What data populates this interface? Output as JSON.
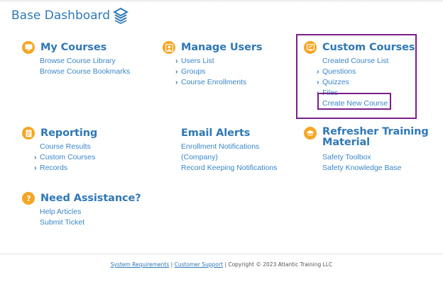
{
  "page": {
    "title": "Base Dashboard"
  },
  "colors": {
    "accent": "#2f78b6",
    "link": "#3a86c8",
    "icon_bg": "#f5a623",
    "highlight": "#7b1f8a"
  },
  "sections": {
    "my_courses": {
      "title": "My Courses",
      "icon": "monitor-icon",
      "links": [
        "Browse Course Library",
        "Browse Course Bookmarks"
      ]
    },
    "manage_users": {
      "title": "Manage Users",
      "icon": "user-badge-icon",
      "links": [
        "Users List",
        "Groups",
        "Course Enrollments"
      ]
    },
    "custom_courses": {
      "title": "Custom Courses",
      "icon": "screen-edit-icon",
      "links": [
        "Created Course List",
        "Questions",
        "Quizzes",
        "Files",
        "Create New Course"
      ]
    },
    "reporting": {
      "title": "Reporting",
      "icon": "document-icon",
      "links": [
        "Course Results",
        "Custom Courses",
        "Records"
      ]
    },
    "email_alerts": {
      "title": "Email Alerts",
      "links": [
        "Enrollment Notifications",
        "(Company)",
        "Record Keeping Notifications"
      ]
    },
    "refresher_training": {
      "title_line1": "Refresher Training",
      "title_line2": "Material",
      "icon": "graduation-cap-icon",
      "links": [
        "Safety Toolbox",
        "Safety Knowledge Base"
      ]
    },
    "need_assistance": {
      "title": "Need Assistance?",
      "icon": "question-icon",
      "links": [
        "Help Articles",
        "Submit Ticket"
      ]
    }
  },
  "footer": {
    "system_requirements": "System Requirements",
    "separator": "|",
    "customer_support": "Customer Support",
    "copyright": "| Copyright © 2023 Atlantic Training LLC"
  }
}
